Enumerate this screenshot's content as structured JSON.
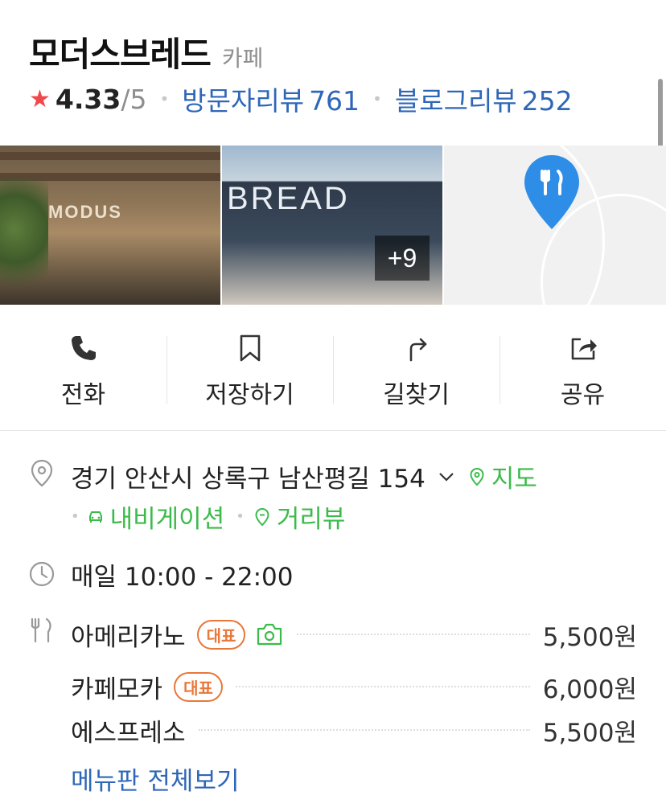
{
  "place": {
    "name": "모더스브레드",
    "category": "카페"
  },
  "rating": {
    "score": "4.33",
    "max": "/5",
    "visitor_review_label": "방문자리뷰",
    "visitor_review_count": "761",
    "blog_review_label": "블로그리뷰",
    "blog_review_count": "252"
  },
  "photos": {
    "photo1_sign": "MODUS",
    "photo2_sign": "BREAD",
    "more_count": "+9"
  },
  "actions": [
    {
      "label": "전화",
      "icon": "phone-icon"
    },
    {
      "label": "저장하기",
      "icon": "bookmark-icon"
    },
    {
      "label": "길찾기",
      "icon": "directions-icon"
    },
    {
      "label": "공유",
      "icon": "share-icon"
    }
  ],
  "address": {
    "text": "경기 안산시 상록구 남산평길 154",
    "map_link": "지도",
    "navigation_link": "내비게이션",
    "street_view_link": "거리뷰"
  },
  "hours": {
    "text": "매일 10:00 - 22:00"
  },
  "menu": {
    "items": [
      {
        "name": "아메리카노",
        "badge": "대표",
        "has_photo": true,
        "price": "5,500원"
      },
      {
        "name": "카페모카",
        "badge": "대표",
        "has_photo": false,
        "price": "6,000원"
      },
      {
        "name": "에스프레소",
        "badge": "",
        "has_photo": false,
        "price": "5,500원"
      }
    ],
    "more_link": "메뉴판 전체보기"
  },
  "colors": {
    "link_blue": "#2f67b8",
    "link_green": "#3cbb4b",
    "badge_orange": "#e8773a",
    "star_red": "#f0484b",
    "pin_blue": "#2e8de6"
  }
}
